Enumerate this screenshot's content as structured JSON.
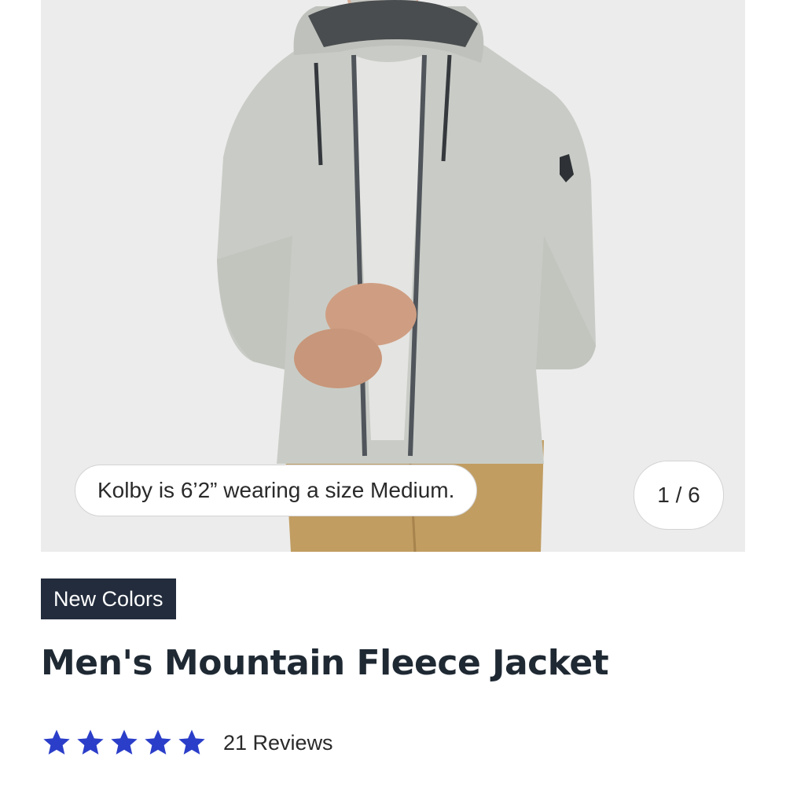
{
  "product": {
    "image_caption": "Kolby is 6’2” wearing a size Medium.",
    "image_counter": "1 / 6",
    "badge": "New Colors",
    "title": "Men's Mountain Fleece Jacket",
    "rating": {
      "stars": 5,
      "max_stars": 5,
      "reviews_label": "21 Reviews"
    }
  },
  "colors": {
    "star": "#2b3ec9",
    "badge_bg": "#222c3c",
    "title": "#1f2933",
    "gallery_bg": "#ececec",
    "jacket": "#c9ccc6",
    "pants": "#c19d62"
  },
  "icons": {
    "rating_star": "star-icon"
  }
}
